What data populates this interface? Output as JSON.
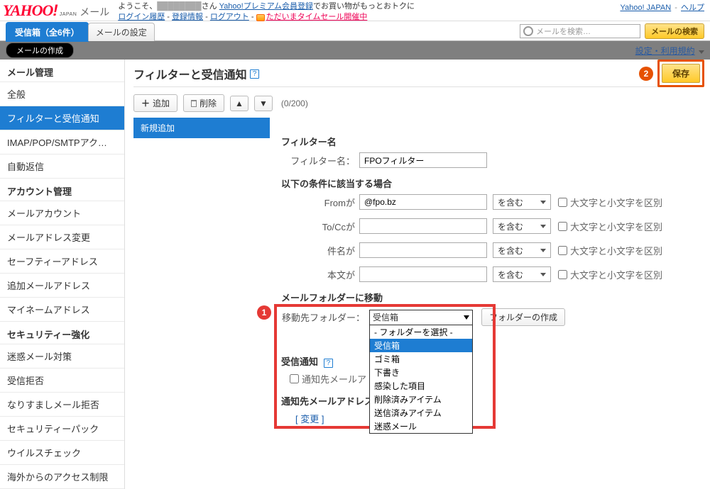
{
  "top": {
    "logo_label": "メール",
    "greeting_prefix": "ようこそ、",
    "greeting_suffix": "さん",
    "premium_link": "Yahoo!プレミアム会員登録",
    "premium_tail": "でお買い物がもっとおトクに",
    "links": {
      "login_history": "ログイン履歴",
      "reg_info": "登録情報",
      "logout": "ログアウト",
      "timesale": "ただいまタイムセール開催中"
    },
    "right": {
      "yahoo_japan": "Yahoo! JAPAN",
      "help": "ヘルプ"
    }
  },
  "tabs": {
    "inbox": "受信箱（全6件）",
    "mail_settings": "メールの設定"
  },
  "search": {
    "placeholder": "メールを検索…",
    "button": "メールの検索"
  },
  "subbar": {
    "compose": "メールの作成",
    "settings_link": "設定・利用規約"
  },
  "sidebar": {
    "group_mail": "メール管理",
    "mail_items": [
      "全般",
      "フィルターと受信通知",
      "IMAP/POP/SMTPアク…",
      "自動返信"
    ],
    "group_account": "アカウント管理",
    "account_items": [
      "メールアカウント",
      "メールアドレス変更",
      "セーフティーアドレス",
      "追加メールアドレス",
      "マイネームアドレス"
    ],
    "group_security": "セキュリティー強化",
    "security_items": [
      "迷惑メール対策",
      "受信拒否",
      "なりすましメール拒否",
      "セキュリティーパック",
      "ウイルスチェック",
      "海外からのアクセス制限"
    ]
  },
  "content": {
    "title": "フィルターと受信通知",
    "save": "保存",
    "add_btn": "追加",
    "del_btn": "削除",
    "counter": "0/200",
    "list_item": "新規追加",
    "section_name": "フィルター名",
    "label_name": "フィルター名：",
    "value_name": "FPOフィルター",
    "section_cond": "以下の条件に該当する場合",
    "label_from": "Fromが",
    "value_from": "@fpo.bz",
    "label_tocc": "To/Ccが",
    "label_subject": "件名が",
    "label_body": "本文が",
    "contains": "を含む",
    "case_label": "大文字と小文字を区別",
    "section_folder": "メールフォルダーに移動",
    "label_folder": "移動先フォルダー：",
    "folder_selected": "受信箱",
    "folder_placeholder": "- フォルダーを選択 -",
    "folder_options": [
      "受信箱",
      "ゴミ箱",
      "下書き",
      "感染した項目",
      "削除済みアイテム",
      "送信済みアイテム",
      "迷惑メール"
    ],
    "create_folder": "フォルダーの作成",
    "section_notify": "受信通知",
    "notify_checkbox_label": "通知先メールア",
    "section_notify_addr": "通知先メールアドレス",
    "change_link": "[ 変更 ]"
  }
}
